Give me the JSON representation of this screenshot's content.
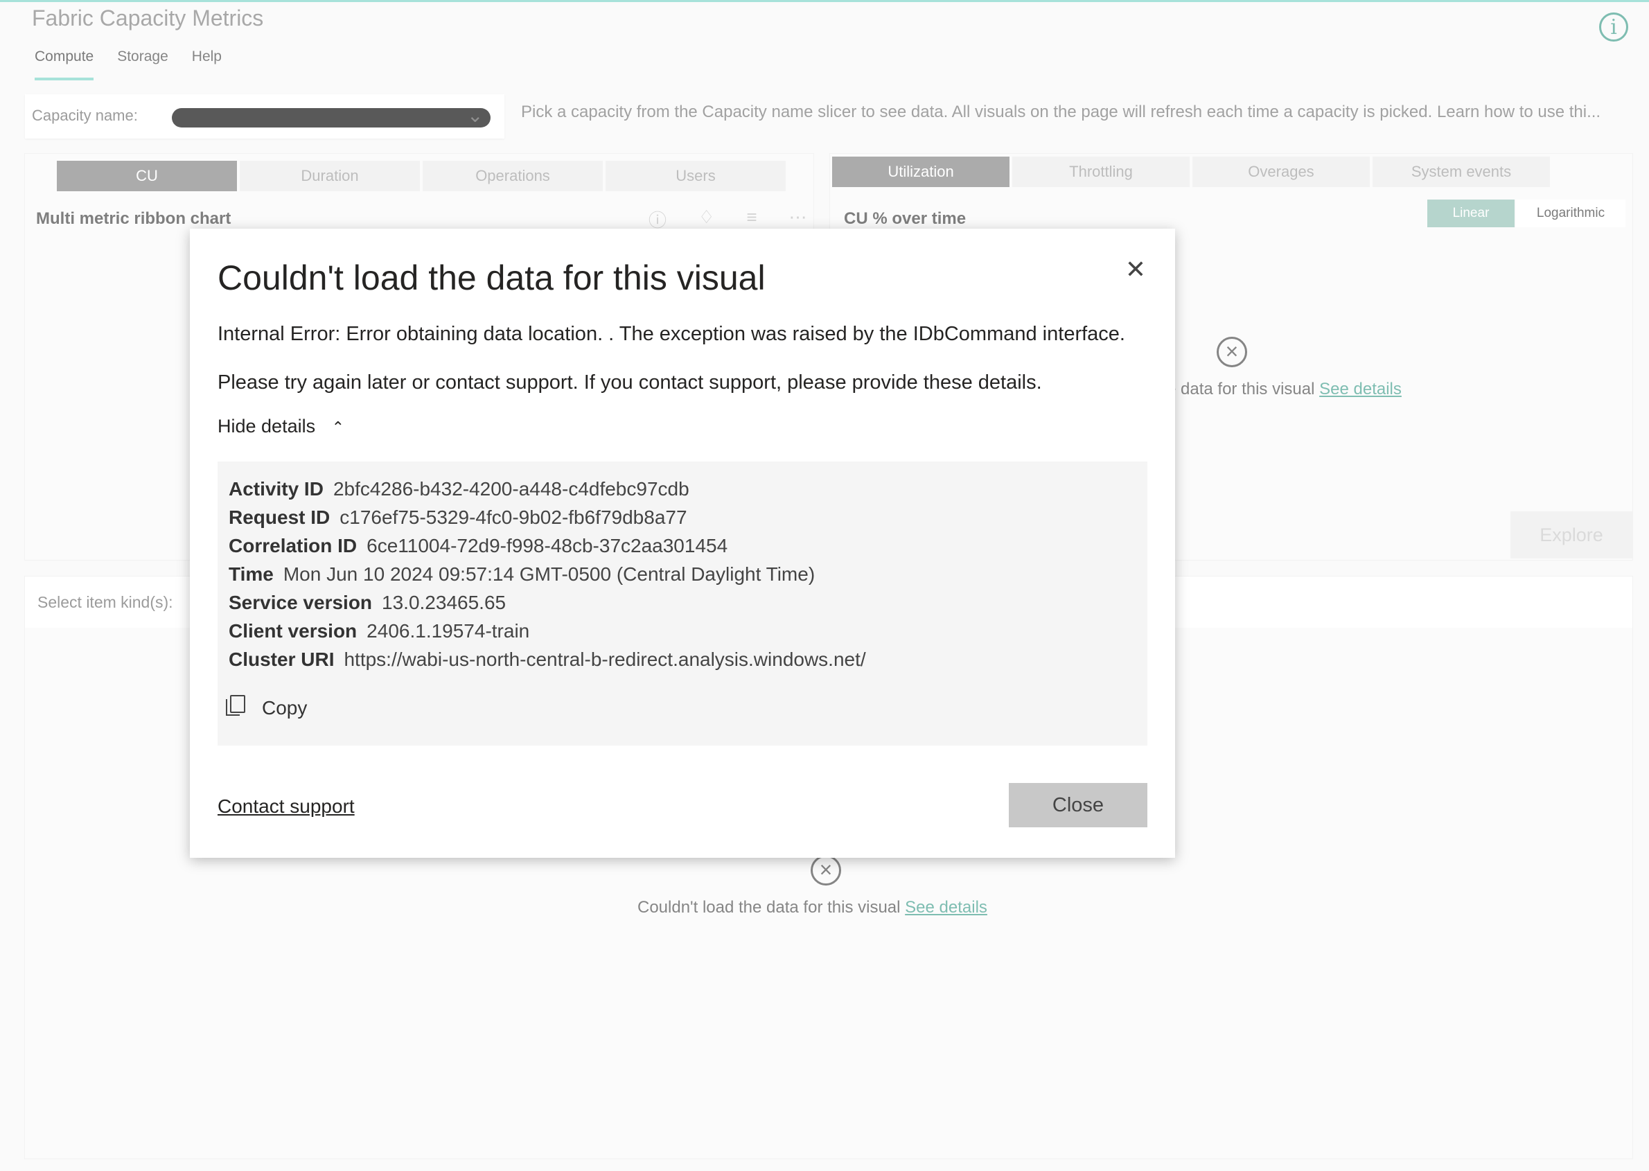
{
  "app": {
    "title": "Fabric Capacity Metrics"
  },
  "nav": [
    {
      "label": "Compute"
    },
    {
      "label": "Storage"
    },
    {
      "label": "Help"
    }
  ],
  "slicer": {
    "label": "Capacity name:"
  },
  "hint": "Pick a capacity from the Capacity name slicer to see data. All visuals on the page will refresh each time a capacity is picked. Learn how to use thi...",
  "left_panel": {
    "tabs": [
      {
        "label": "CU"
      },
      {
        "label": "Duration"
      },
      {
        "label": "Operations"
      },
      {
        "label": "Users"
      }
    ],
    "title": "Multi metric ribbon chart"
  },
  "right_panel": {
    "tabs": [
      {
        "label": "Utilization"
      },
      {
        "label": "Throttling"
      },
      {
        "label": "Overages"
      },
      {
        "label": "System events"
      }
    ],
    "title": "CU % over time",
    "scale": {
      "linear": "Linear",
      "log": "Logarithmic"
    },
    "error_text": "e data for this visual",
    "see_details": "See details",
    "explore": "Explore"
  },
  "bottom_panel": {
    "label": "Select item kind(s):",
    "error_text": "Couldn't load the data for this visual",
    "see_details": "See details"
  },
  "dialog": {
    "title": "Couldn't load the data for this visual",
    "message": "Internal Error: Error obtaining data location. . The exception was raised by the IDbCommand interface.",
    "support_message": "Please try again later or contact support. If you contact support, please provide these details.",
    "toggle": "Hide details",
    "details": [
      {
        "label": "Activity ID",
        "value": "2bfc4286-b432-4200-a448-c4dfebc97cdb"
      },
      {
        "label": "Request ID",
        "value": "c176ef75-5329-4fc0-9b02-fb6f79db8a77"
      },
      {
        "label": "Correlation ID",
        "value": "6ce11004-72d9-f998-48cb-37c2aa301454"
      },
      {
        "label": "Time",
        "value": "Mon Jun 10 2024 09:57:14 GMT-0500 (Central Daylight Time)"
      },
      {
        "label": "Service version",
        "value": "13.0.23465.65"
      },
      {
        "label": "Client version",
        "value": "2406.1.19574-train"
      },
      {
        "label": "Cluster URI",
        "value": "https://wabi-us-north-central-b-redirect.analysis.windows.net/"
      }
    ],
    "copy": "Copy",
    "contact_support": "Contact support",
    "close": "Close"
  },
  "colors": {
    "accent": "#79d3c6",
    "link": "#3a9a88",
    "tab_active": "#7f7f7f"
  }
}
